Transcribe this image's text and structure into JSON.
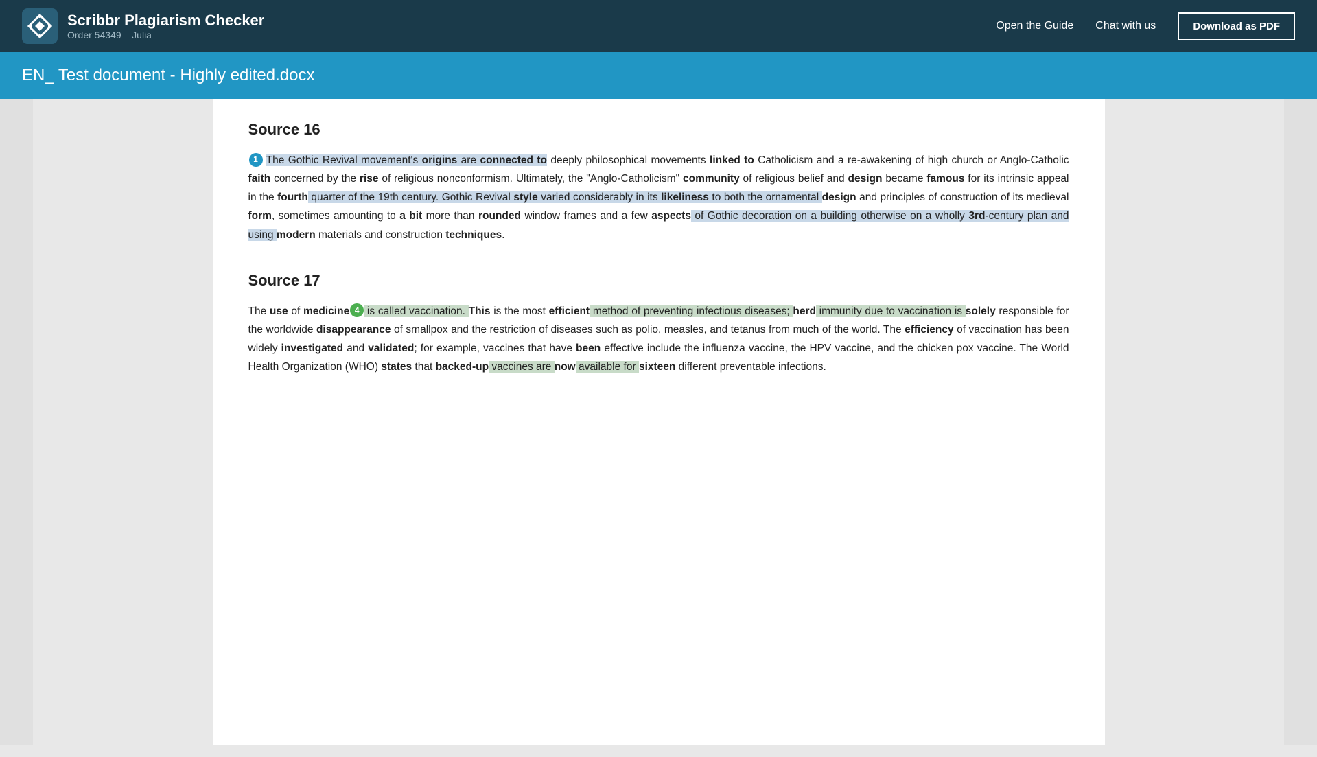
{
  "header": {
    "logo_alt": "Scribbr logo",
    "title": "Scribbr Plagiarism Checker",
    "subtitle": "Order 54349 – Julia",
    "open_guide_label": "Open the Guide",
    "chat_label": "Chat with us",
    "download_pdf_label": "Download as PDF"
  },
  "doc_title_bar": {
    "filename": "EN_ Test document - Highly edited.docx"
  },
  "sources": [
    {
      "id": "source16",
      "heading": "Source 16",
      "badge_number": "1",
      "badge_type": "blue",
      "paragraph": [
        {
          "type": "hl-blue",
          "text": "The Gothic Revival movement's "
        },
        {
          "type": "hl-blue bold",
          "text": "origins"
        },
        {
          "type": "hl-blue",
          "text": " are "
        },
        {
          "type": "hl-blue bold",
          "text": "connected to"
        },
        {
          "type": "plain",
          "text": " deeply philosophical movements "
        },
        {
          "type": "bold",
          "text": "linked to"
        },
        {
          "type": "plain",
          "text": " Catholicism and a re-awakening of high church or Anglo-Catholic "
        },
        {
          "type": "bold",
          "text": "faith"
        },
        {
          "type": "plain",
          "text": " concerned by the "
        },
        {
          "type": "bold",
          "text": "rise"
        },
        {
          "type": "plain",
          "text": " of religious nonconformism. Ultimately, the \"Anglo-Catholicism\" "
        },
        {
          "type": "bold",
          "text": "community"
        },
        {
          "type": "plain",
          "text": " of religious belief and "
        },
        {
          "type": "bold",
          "text": "design"
        },
        {
          "type": "plain",
          "text": " became "
        },
        {
          "type": "bold",
          "text": "famous"
        },
        {
          "type": "plain",
          "text": " for its intrinsic appeal in the "
        },
        {
          "type": "bold",
          "text": "fourth"
        },
        {
          "type": "hl-blue",
          "text": " quarter of the 19th century. Gothic Revival "
        },
        {
          "type": "hl-blue bold",
          "text": "style"
        },
        {
          "type": "hl-blue",
          "text": " varied considerably in its "
        },
        {
          "type": "hl-blue bold",
          "text": "likeliness"
        },
        {
          "type": "hl-blue",
          "text": " to both the ornamental "
        },
        {
          "type": "bold",
          "text": "design"
        },
        {
          "type": "plain",
          "text": " and principles of construction of its medieval "
        },
        {
          "type": "bold",
          "text": "form"
        },
        {
          "type": "plain",
          "text": ", sometimes amounting to "
        },
        {
          "type": "bold",
          "text": "a bit"
        },
        {
          "type": "plain",
          "text": " more than "
        },
        {
          "type": "bold",
          "text": "rounded"
        },
        {
          "type": "plain",
          "text": " window frames and a few "
        },
        {
          "type": "bold",
          "text": "aspects"
        },
        {
          "type": "hl-blue",
          "text": " of Gothic decoration on a building otherwise on a wholly "
        },
        {
          "type": "hl-blue bold",
          "text": "3rd"
        },
        {
          "type": "hl-blue",
          "text": "-century plan and using "
        },
        {
          "type": "bold",
          "text": "modern"
        },
        {
          "type": "plain",
          "text": " materials and construction "
        },
        {
          "type": "bold",
          "text": "techniques"
        },
        {
          "type": "plain",
          "text": "."
        }
      ]
    },
    {
      "id": "source17",
      "heading": "Source 17",
      "badge_number": "4",
      "badge_type": "green",
      "paragraph": [
        {
          "type": "plain",
          "text": "The "
        },
        {
          "type": "bold",
          "text": "use"
        },
        {
          "type": "plain",
          "text": " of "
        },
        {
          "type": "bold",
          "text": "medicine"
        },
        {
          "type": "hl-green",
          "text": " is called vaccination. "
        },
        {
          "type": "bold",
          "text": "This"
        },
        {
          "type": "plain",
          "text": " is the most "
        },
        {
          "type": "bold",
          "text": "efficient"
        },
        {
          "type": "hl-green",
          "text": " method of preventing infectious diseases; "
        },
        {
          "type": "bold",
          "text": "herd"
        },
        {
          "type": "hl-green",
          "text": " immunity due to vaccination is "
        },
        {
          "type": "bold",
          "text": "solely"
        },
        {
          "type": "plain",
          "text": " responsible for the worldwide "
        },
        {
          "type": "bold",
          "text": "disappearance"
        },
        {
          "type": "plain",
          "text": " of smallpox and the restriction of diseases such as polio, measles, and tetanus from much of the world. The "
        },
        {
          "type": "bold",
          "text": "efficiency"
        },
        {
          "type": "plain",
          "text": " of vaccination has been widely "
        },
        {
          "type": "bold",
          "text": "investigated"
        },
        {
          "type": "plain",
          "text": " and "
        },
        {
          "type": "bold",
          "text": "validated"
        },
        {
          "type": "plain",
          "text": "; for example, vaccines that have "
        },
        {
          "type": "bold",
          "text": "been"
        },
        {
          "type": "plain",
          "text": " effective include the influenza vaccine, the HPV vaccine, and the chicken pox vaccine. The World Health Organization (WHO) "
        },
        {
          "type": "bold",
          "text": "states"
        },
        {
          "type": "plain",
          "text": " that "
        },
        {
          "type": "bold",
          "text": "backed-up"
        },
        {
          "type": "hl-green",
          "text": " vaccines are "
        },
        {
          "type": "bold",
          "text": "now"
        },
        {
          "type": "hl-green",
          "text": " available for "
        },
        {
          "type": "bold",
          "text": "sixteen"
        },
        {
          "type": "plain",
          "text": " different preventable infections."
        }
      ]
    }
  ]
}
